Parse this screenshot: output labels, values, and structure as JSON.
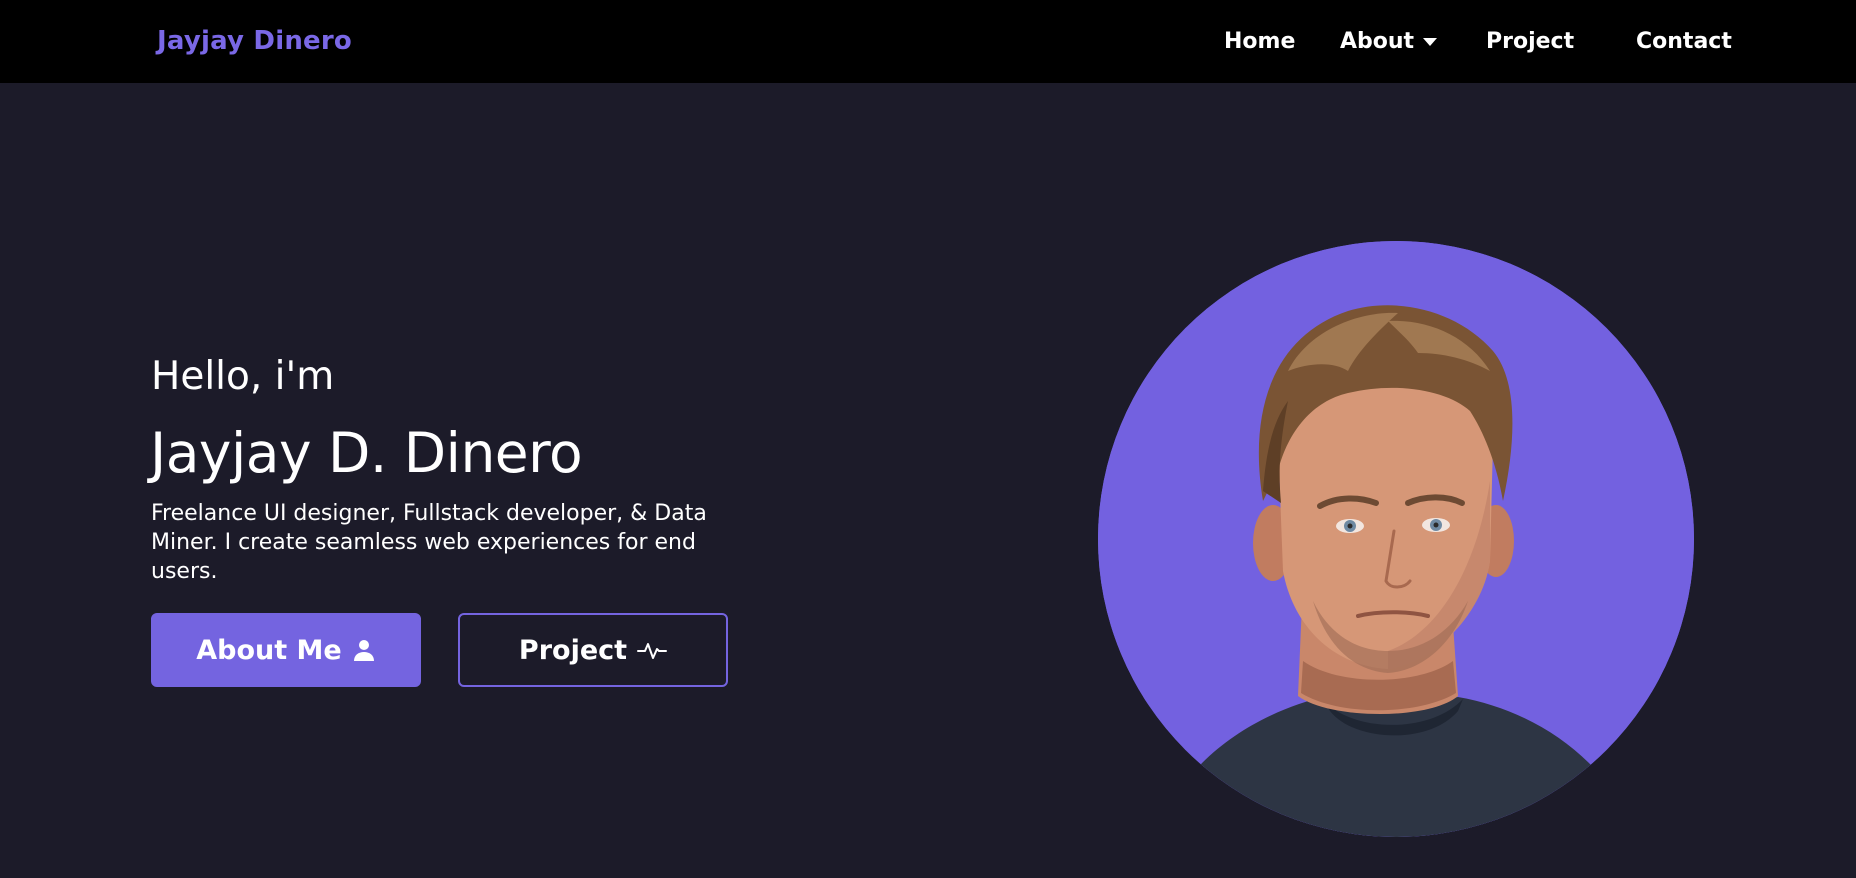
{
  "nav": {
    "brand": "Jayjay Dinero",
    "links": [
      {
        "label": "Home"
      },
      {
        "label": "About"
      },
      {
        "label": "Project"
      },
      {
        "label": "Contact"
      }
    ]
  },
  "hero": {
    "greeting": "Hello, i'm",
    "name": "Jayjay D. Dinero",
    "description": "Freelance UI designer, Fullstack developer, & Data Miner. I create seamless web experiences for end users.",
    "buttons": {
      "about_me": {
        "label": "About Me",
        "icon": "user-icon"
      },
      "project": {
        "label": "Project",
        "icon": "activity-icon"
      }
    }
  },
  "colors": {
    "accent": "#7464e0",
    "brand": "#7a68e6",
    "background": "#1c1b29",
    "navbar": "#000000"
  }
}
